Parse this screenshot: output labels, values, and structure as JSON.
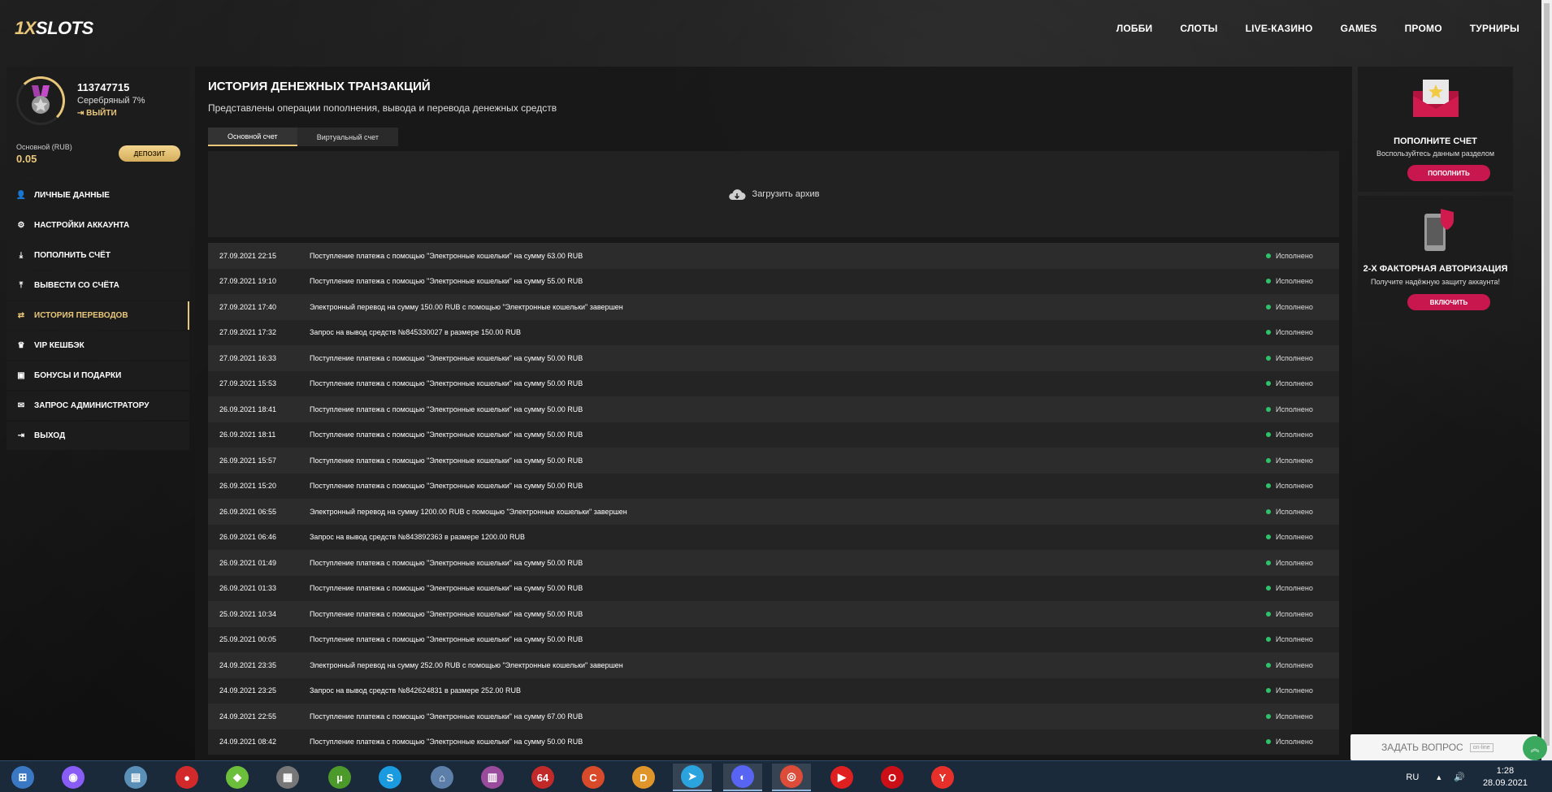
{
  "colors": {
    "accent": "#e9c77a",
    "primary_button": "#c8174f",
    "status_ok": "#2ec26a"
  },
  "logo": {
    "part1": "1X",
    "part2": "SLOTS"
  },
  "nav": [
    "ЛОББИ",
    "СЛОТЫ",
    "LIVE-КАЗИНО",
    "GAMES",
    "ПРОМО",
    "ТУРНИРЫ"
  ],
  "profile": {
    "user_id": "113747715",
    "level": "Серебряный 7%",
    "logout": "ВЫЙТИ",
    "balance_label": "Основной (RUB)",
    "balance_value": "0.05",
    "deposit": "ДЕПОЗИТ"
  },
  "menu": [
    {
      "label": "ЛИЧНЫЕ ДАННЫЕ",
      "icon": "user-icon",
      "glyph": "👤"
    },
    {
      "label": "НАСТРОЙКИ АККАУНТА",
      "icon": "gears-icon",
      "glyph": "⚙"
    },
    {
      "label": "ПОПОЛНИТЬ СЧЁТ",
      "icon": "download-icon",
      "glyph": "⤓"
    },
    {
      "label": "ВЫВЕСТИ СО СЧЁТА",
      "icon": "upload-icon",
      "glyph": "⤒"
    },
    {
      "label": "ИСТОРИЯ ПЕРЕВОДОВ",
      "icon": "transfer-icon",
      "glyph": "⇄",
      "active": true
    },
    {
      "label": "VIP КЕШБЭК",
      "icon": "crown-icon",
      "glyph": "♛"
    },
    {
      "label": "БОНУСЫ И ПОДАРКИ",
      "icon": "gift-icon",
      "glyph": "▣"
    },
    {
      "label": "ЗАПРОС АДМИНИСТРАТОРУ",
      "icon": "envelope-icon",
      "glyph": "✉"
    },
    {
      "label": "ВЫХОД",
      "icon": "exit-icon",
      "glyph": "⇥"
    }
  ],
  "main": {
    "title": "ИСТОРИЯ ДЕНЕЖНЫХ ТРАНЗАКЦИЙ",
    "subtitle": "Представлены операции пополнения, вывода и перевода денежных средств",
    "tabs": [
      "Основной счет",
      "Виртуальный счет"
    ],
    "archive": "Загрузить архив"
  },
  "transactions": [
    {
      "date": "27.09.2021 22:15",
      "desc": "Поступление платежа с помощью \"Электронные кошельки\" на сумму 63.00 RUB",
      "status": "Исполнено"
    },
    {
      "date": "27.09.2021 19:10",
      "desc": "Поступление платежа с помощью \"Электронные кошельки\" на сумму 55.00 RUB",
      "status": "Исполнено"
    },
    {
      "date": "27.09.2021 17:40",
      "desc": "Электронный перевод на сумму 150.00 RUB с помощью \"Электронные кошельки\" завершен",
      "status": "Исполнено"
    },
    {
      "date": "27.09.2021 17:32",
      "desc": "Запрос на вывод средств №845330027 в размере 150.00 RUB",
      "status": "Исполнено"
    },
    {
      "date": "27.09.2021 16:33",
      "desc": "Поступление платежа с помощью \"Электронные кошельки\" на сумму 50.00 RUB",
      "status": "Исполнено"
    },
    {
      "date": "27.09.2021 15:53",
      "desc": "Поступление платежа с помощью \"Электронные кошельки\" на сумму 50.00 RUB",
      "status": "Исполнено"
    },
    {
      "date": "26.09.2021 18:41",
      "desc": "Поступление платежа с помощью \"Электронные кошельки\" на сумму 50.00 RUB",
      "status": "Исполнено"
    },
    {
      "date": "26.09.2021 18:11",
      "desc": "Поступление платежа с помощью \"Электронные кошельки\" на сумму 50.00 RUB",
      "status": "Исполнено"
    },
    {
      "date": "26.09.2021 15:57",
      "desc": "Поступление платежа с помощью \"Электронные кошельки\" на сумму 50.00 RUB",
      "status": "Исполнено"
    },
    {
      "date": "26.09.2021 15:20",
      "desc": "Поступление платежа с помощью \"Электронные кошельки\" на сумму 50.00 RUB",
      "status": "Исполнено"
    },
    {
      "date": "26.09.2021 06:55",
      "desc": "Электронный перевод на сумму 1200.00 RUB с помощью \"Электронные кошельки\" завершен",
      "status": "Исполнено"
    },
    {
      "date": "26.09.2021 06:46",
      "desc": "Запрос на вывод средств №843892363 в размере 1200.00 RUB",
      "status": "Исполнено"
    },
    {
      "date": "26.09.2021 01:49",
      "desc": "Поступление платежа с помощью \"Электронные кошельки\" на сумму 50.00 RUB",
      "status": "Исполнено"
    },
    {
      "date": "26.09.2021 01:33",
      "desc": "Поступление платежа с помощью \"Электронные кошельки\" на сумму 50.00 RUB",
      "status": "Исполнено"
    },
    {
      "date": "25.09.2021 10:34",
      "desc": "Поступление платежа с помощью \"Электронные кошельки\" на сумму 50.00 RUB",
      "status": "Исполнено"
    },
    {
      "date": "25.09.2021 00:05",
      "desc": "Поступление платежа с помощью \"Электронные кошельки\" на сумму 50.00 RUB",
      "status": "Исполнено"
    },
    {
      "date": "24.09.2021 23:35",
      "desc": "Электронный перевод на сумму 252.00 RUB с помощью \"Электронные кошельки\" завершен",
      "status": "Исполнено"
    },
    {
      "date": "24.09.2021 23:25",
      "desc": "Запрос на вывод средств №842624831 в размере 252.00 RUB",
      "status": "Исполнено"
    },
    {
      "date": "24.09.2021 22:55",
      "desc": "Поступление платежа с помощью \"Электронные кошельки\" на сумму 67.00 RUB",
      "status": "Исполнено"
    },
    {
      "date": "24.09.2021 08:42",
      "desc": "Поступление платежа с помощью \"Электронные кошельки\" на сумму 50.00 RUB",
      "status": "Исполнено"
    }
  ],
  "promo": {
    "deposit_title": "ПОПОЛНИТЕ СЧЕТ",
    "deposit_sub": "Воспользуйтесь данным разделом",
    "deposit_btn": "ПОПОЛНИТЬ",
    "twofa_title": "2-Х ФАКТОРНАЯ АВТОРИЗАЦИЯ",
    "twofa_sub": "Получите надёжную защиту аккаунта!",
    "twofa_btn": "ВКЛЮЧИТЬ"
  },
  "chat": {
    "label": "ЗАДАТЬ ВОПРОС",
    "badge": "on-line"
  },
  "taskbar": {
    "apps": [
      {
        "name": "start-icon",
        "glyph": "⊞",
        "color": "#3b78c4"
      },
      {
        "name": "alice-icon",
        "glyph": "◉",
        "color": "#8a5cf6"
      },
      {
        "name": "notes-icon",
        "glyph": "▤",
        "color": "#5a8fb8"
      },
      {
        "name": "record-icon",
        "glyph": "●",
        "color": "#d22a2a"
      },
      {
        "name": "bluestacks-icon",
        "glyph": "◆",
        "color": "#6cbf3a"
      },
      {
        "name": "archive-icon",
        "glyph": "▦",
        "color": "#777777"
      },
      {
        "name": "utorrent-icon",
        "glyph": "µ",
        "color": "#4c9a2a"
      },
      {
        "name": "skype-icon",
        "glyph": "S",
        "color": "#1a9be0"
      },
      {
        "name": "network-icon",
        "glyph": "⌂",
        "color": "#5b7fa8"
      },
      {
        "name": "winrar-icon",
        "glyph": "▥",
        "color": "#9b4b9b"
      },
      {
        "name": "aida64-icon",
        "glyph": "64",
        "color": "#c22a2a"
      },
      {
        "name": "ccleaner-icon",
        "glyph": "C",
        "color": "#d84a2a"
      },
      {
        "name": "dlink-icon",
        "glyph": "D",
        "color": "#e0952a"
      },
      {
        "name": "telegram-icon",
        "glyph": "➤",
        "color": "#2aa3de"
      },
      {
        "name": "discord-icon",
        "glyph": "◐",
        "color": "#5865f2"
      },
      {
        "name": "chrome-icon",
        "glyph": "◎",
        "color": "#dd4b39"
      },
      {
        "name": "youtube-icon",
        "glyph": "▶",
        "color": "#e02020"
      },
      {
        "name": "opera-icon",
        "glyph": "O",
        "color": "#cc0f16"
      },
      {
        "name": "yandex-icon",
        "glyph": "Y",
        "color": "#e8302a"
      }
    ],
    "lang": "RU",
    "time": "1:28",
    "date": "28.09.2021"
  }
}
